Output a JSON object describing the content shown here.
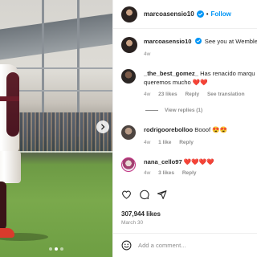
{
  "post": {
    "author": "marcoasensio10",
    "follow_label": "Follow",
    "separator": "•",
    "caption_text": "See you at Wembley",
    "caption_time": "4w"
  },
  "comments": [
    {
      "username": "_the_best_gomez_",
      "text": "Has renacido marqu",
      "text_line2": "queremos mucho ❤️❤️",
      "time": "4w",
      "likes": "23 likes",
      "reply": "Reply",
      "translation": "See translation",
      "view_replies": "View replies (1)"
    },
    {
      "username": "rodrigoorebolloo",
      "text": "Booof 😍😍",
      "time": "4w",
      "likes": "1 like",
      "reply": "Reply"
    },
    {
      "username": "nana_cello97",
      "text": "❤️❤️❤️❤️",
      "time": "4w",
      "likes": "3 likes",
      "reply": "Reply"
    }
  ],
  "stats": {
    "likes": "307,944 likes",
    "date": "March 30"
  },
  "add_comment": {
    "placeholder": "Add a comment..."
  },
  "icons": {
    "verified": "verified-badge-icon",
    "like": "heart-icon",
    "comment": "comment-bubble-icon",
    "share": "paper-plane-icon",
    "emoji": "smiley-icon",
    "next": "chevron-right-icon"
  },
  "colors": {
    "link_blue": "#0095f6",
    "muted": "#8e8e8e"
  },
  "carousel": {
    "slides": 3,
    "active": 1
  }
}
